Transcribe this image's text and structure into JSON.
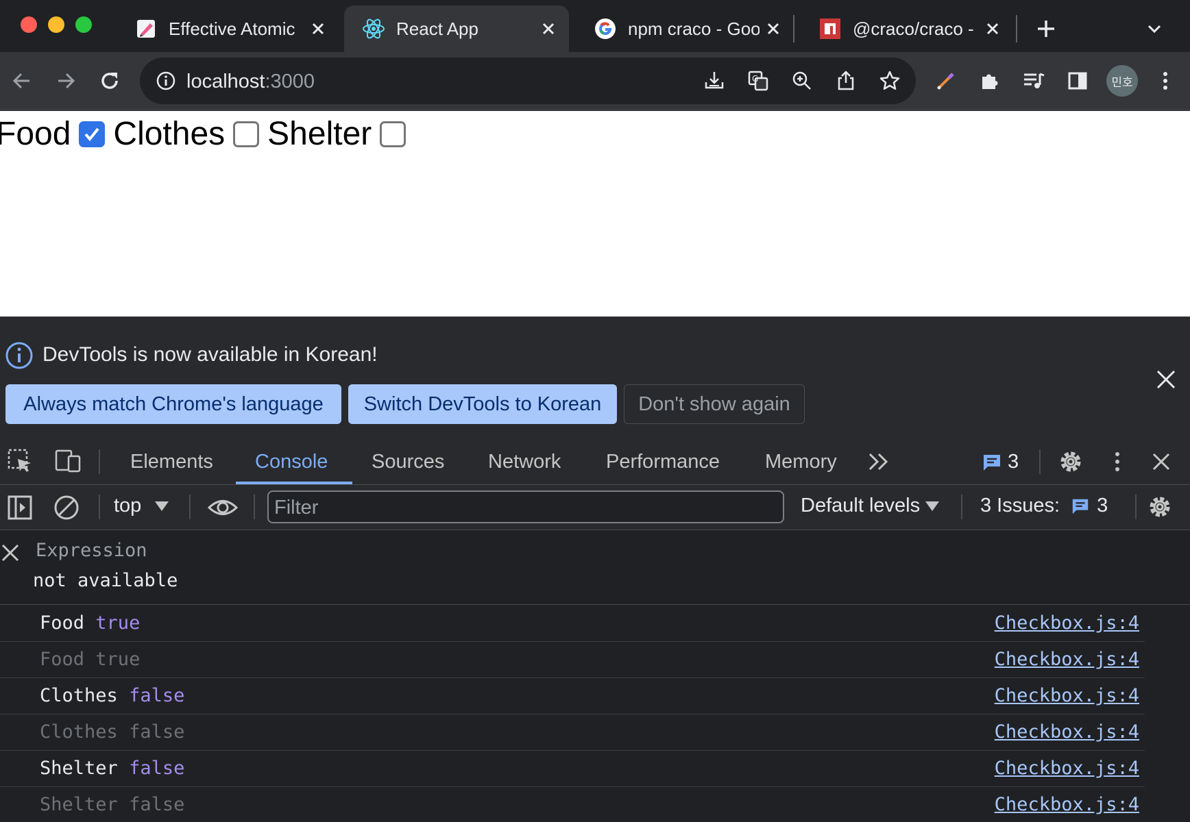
{
  "browser": {
    "tabs": [
      {
        "title": "Effective Atomic",
        "favicon": "pencil-doc-icon",
        "active": false
      },
      {
        "title": "React App",
        "favicon": "react-icon",
        "active": true
      },
      {
        "title": "npm craco - Goo",
        "favicon": "google-icon",
        "active": false
      },
      {
        "title": "@craco/craco - r",
        "favicon": "npm-icon",
        "active": false
      }
    ],
    "address": {
      "host": "localhost",
      "port": ":3000"
    },
    "avatar_text": "민호"
  },
  "page": {
    "checkboxes": [
      {
        "label": "Food",
        "checked": true
      },
      {
        "label": "Clothes",
        "checked": false
      },
      {
        "label": "Shelter",
        "checked": false
      }
    ]
  },
  "devtools": {
    "infobar": {
      "message": "DevTools is now available in Korean!",
      "buttons": [
        "Always match Chrome's language",
        "Switch DevTools to Korean",
        "Don't show again"
      ]
    },
    "tabs": [
      "Elements",
      "Console",
      "Sources",
      "Network",
      "Performance",
      "Memory"
    ],
    "active_tab": "Console",
    "issues_badge": "3",
    "console_toolbar": {
      "context": "top",
      "filter_placeholder": "Filter",
      "levels": "Default levels",
      "issues_label": "3 Issues:",
      "issues_count": "3"
    },
    "live_expression": {
      "label": "Expression",
      "value": "not available"
    },
    "logs": [
      {
        "key": "Food",
        "value": "true",
        "source": "Checkbox.js:4",
        "dim": false
      },
      {
        "key": "Food",
        "value": "true",
        "source": "Checkbox.js:4",
        "dim": true
      },
      {
        "key": "Clothes",
        "value": "false",
        "source": "Checkbox.js:4",
        "dim": false
      },
      {
        "key": "Clothes",
        "value": "false",
        "source": "Checkbox.js:4",
        "dim": true
      },
      {
        "key": "Shelter",
        "value": "false",
        "source": "Checkbox.js:4",
        "dim": false
      },
      {
        "key": "Shelter",
        "value": "false",
        "source": "Checkbox.js:4",
        "dim": true
      }
    ]
  },
  "colors": {
    "accent": "#7cacf8",
    "checkbox_checked": "#2f73e6",
    "console_value": "#a58cf0",
    "link": "#a8c7fa"
  }
}
